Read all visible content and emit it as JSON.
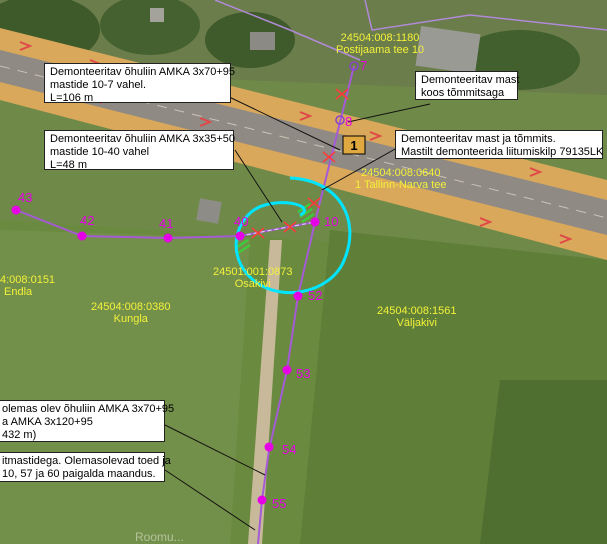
{
  "colors": {
    "line": "#a55ad6",
    "pole": "#e600e6",
    "parcel_label": "#f3f13a",
    "marker": "#00e5ff",
    "callout_bg": "#ffffff",
    "road": "#d9a85b",
    "cross": "#ff3a3a"
  },
  "callouts": [
    {
      "lines": [
        "Demonteeritav õhuliin AMKA 3x70+95",
        "mastide 10-7 vahel.",
        "L=106 m"
      ]
    },
    {
      "lines": [
        "Demonteeritav mast",
        "koos tõmmitsaga"
      ]
    },
    {
      "lines": [
        "Demonteeritav õhuliin AMKA 3x35+50",
        "mastide 10-40 vahel",
        "L=48 m"
      ]
    },
    {
      "lines": [
        "Demonteeritav mast ja tõmmits.",
        "Mastilt demonteerida liitumiskilp 79135LK"
      ]
    },
    {
      "lines": [
        "olemas olev õhuliin AMKA 3x70+95",
        "a AMKA 3x120+95",
        "432 m)"
      ]
    },
    {
      "lines": [
        "itmastidega. Olemasolevad toed ja",
        "10, 57 ja 60 paigalda maandus."
      ]
    }
  ],
  "parcels": [
    {
      "id": "24504:008:1180",
      "name": "Postijaama tee 10"
    },
    {
      "id": "24504:008:0640",
      "name": "1 Tallinn-Narva tee"
    },
    {
      "id": "4:008:0151",
      "name": "Endla"
    },
    {
      "id": "24504:008:0380",
      "name": "Kungla"
    },
    {
      "id": "24501:001:0873",
      "name": "Osakivi"
    },
    {
      "id": "24504:008:1561",
      "name": "Väljakivi"
    }
  ],
  "poles": [
    "7",
    "8",
    "10",
    "40",
    "41",
    "42",
    "43",
    "52",
    "53",
    "54",
    "55"
  ],
  "road_number": "1",
  "watermark": "Roomu..."
}
